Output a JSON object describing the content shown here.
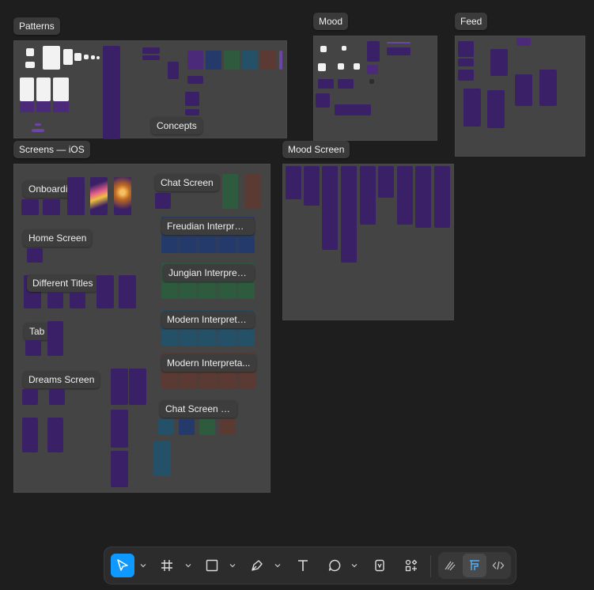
{
  "canvas": {
    "background": "#1e1e1e",
    "section_color": "#444444"
  },
  "sections": {
    "patterns": "Patterns",
    "mood": "Mood",
    "feed": "Feed",
    "screens_ios": "Screens — iOS",
    "mood_screen": "Mood Screen"
  },
  "frames": {
    "concepts": "Concepts",
    "onboarding": "Onboarding",
    "home_screen": "Home Screen",
    "different_titles": "Different Titles",
    "tab": "Tab ...",
    "dreams_screen": "Dreams Screen",
    "chat_screen": "Chat Screen",
    "freudian": "Freudian Interpret...",
    "jungian": "Jungian Interpreta...",
    "modern_1": "Modern Interpreta...",
    "modern_2": "Modern Interpreta...",
    "chat_screen_n": "Chat Screen N..."
  },
  "toolbar": {
    "accent": "#0d99ff",
    "tools": [
      "move-tool",
      "frame-tool",
      "shape-tool",
      "pen-tool",
      "text-tool",
      "comment-tool",
      "resources-tool"
    ],
    "modes": [
      "draw-mode",
      "design-mode",
      "dev-mode"
    ],
    "active_tool": "move-tool",
    "active_mode": "design-mode"
  }
}
